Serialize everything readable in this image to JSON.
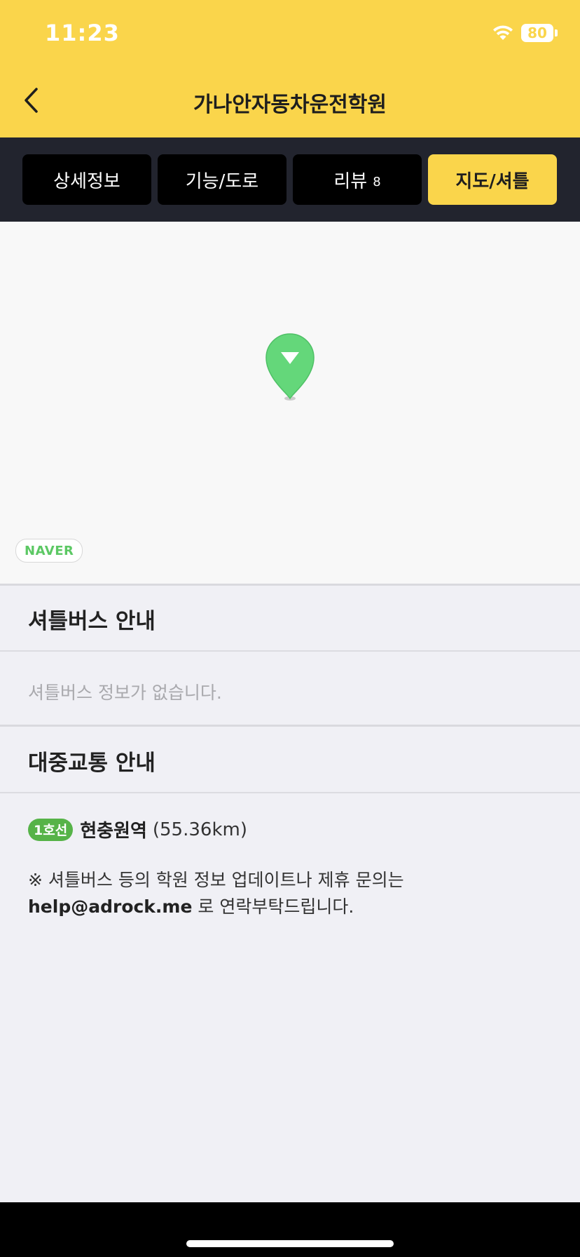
{
  "status_bar": {
    "time": "11:23",
    "battery": "80"
  },
  "header": {
    "title": "가나안자동차운전학원",
    "back_icon": "chevron-left-icon"
  },
  "tabs": [
    {
      "label": "상세정보",
      "count": ""
    },
    {
      "label": "기능/도로",
      "count": ""
    },
    {
      "label": "리뷰",
      "count": "8"
    },
    {
      "label": "지도/셔틀",
      "count": ""
    }
  ],
  "active_tab": 3,
  "map": {
    "provider_badge": "NAVER",
    "pin_icon": "map-pin-icon"
  },
  "shuttle": {
    "title": "셔틀버스 안내",
    "empty_message": "셔틀버스 정보가 없습니다."
  },
  "transit": {
    "title": "대중교통 안내",
    "line_badge": "1호선",
    "station_name": "현충원역",
    "distance": "(55.36km)"
  },
  "notice": {
    "line1": "※ 셔틀버스 등의 학원 정보 업데이트나 제휴 문의는",
    "email": "help@adrock.me",
    "line2_suffix": " 로 연락부탁드립니다."
  },
  "colors": {
    "brand_yellow": "#fad54b",
    "tab_bar": "#22242e",
    "pin_green": "#64d77a",
    "line1_green": "#56b348"
  }
}
